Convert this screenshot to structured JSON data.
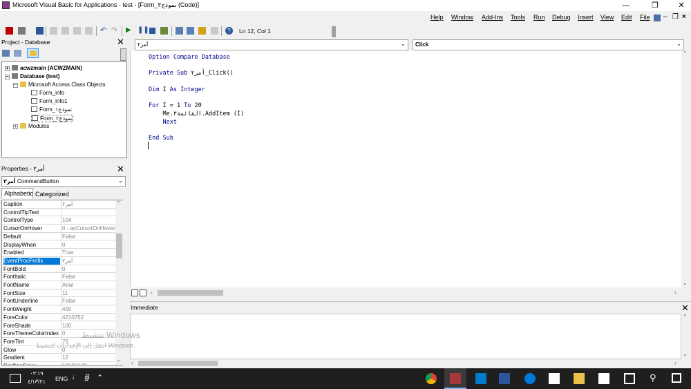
{
  "window": {
    "title": "Microsoft Visual Basic for Applications - test - [Form_نموذج٢ (Code)]"
  },
  "menus": [
    "Help",
    "Window",
    "Add-Ins",
    "Tools",
    "Run",
    "Debug",
    "Insert",
    "View",
    "Edit",
    "File"
  ],
  "toolbar": {
    "position": "Ln 12, Col 1"
  },
  "project": {
    "title": "Project - Database",
    "tree": [
      {
        "label": "acwzmain (ACWZMAIN)",
        "level": 0,
        "bold": true,
        "icon": "project-icon"
      },
      {
        "label": "Database (test)",
        "level": 0,
        "bold": true,
        "icon": "project-icon"
      },
      {
        "label": "Microsoft Access Class Objects",
        "level": 1,
        "bold": false,
        "icon": "folder-icon"
      },
      {
        "label": "Form_info",
        "level": 2,
        "bold": false,
        "icon": "form-icon"
      },
      {
        "label": "Form_info1",
        "level": 2,
        "bold": false,
        "icon": "form-icon"
      },
      {
        "label": "Form_نموذج١",
        "level": 2,
        "bold": false,
        "icon": "form-icon"
      },
      {
        "label": "Form_نموذج٢",
        "level": 2,
        "bold": false,
        "icon": "form-icon"
      },
      {
        "label": "Modules",
        "level": 1,
        "bold": false,
        "icon": "folder-icon"
      }
    ]
  },
  "properties": {
    "title": "Properties - أمر٢",
    "object_name": "أمر٢",
    "object_type": "CommandButton",
    "tabs": [
      "Alphabetic",
      "Categorized"
    ],
    "rows": [
      {
        "name": "Caption",
        "value": "أمر٢"
      },
      {
        "name": "ControlTipText",
        "value": ""
      },
      {
        "name": "ControlType",
        "value": "104"
      },
      {
        "name": "CursorOnHover",
        "value": "0 - acCursorOnHoverDefault"
      },
      {
        "name": "Default",
        "value": "False"
      },
      {
        "name": "DisplayWhen",
        "value": "0"
      },
      {
        "name": "Enabled",
        "value": "True"
      },
      {
        "name": "EventProcPrefix",
        "value": "أمر٢",
        "selected": true
      },
      {
        "name": "FontBold",
        "value": "0"
      },
      {
        "name": "FontItalic",
        "value": "False"
      },
      {
        "name": "FontName",
        "value": "Arial"
      },
      {
        "name": "FontSize",
        "value": "11"
      },
      {
        "name": "FontUnderline",
        "value": "False"
      },
      {
        "name": "FontWeight",
        "value": "400"
      },
      {
        "name": "ForeColor",
        "value": "4210752"
      },
      {
        "name": "ForeShade",
        "value": "100"
      },
      {
        "name": "ForeThemeColorIndex",
        "value": "0"
      },
      {
        "name": "ForeTint",
        "value": "75"
      },
      {
        "name": "Glow",
        "value": "0"
      },
      {
        "name": "Gradient",
        "value": "12"
      },
      {
        "name": "GridlineColor",
        "value": "10921638"
      }
    ]
  },
  "code": {
    "object_combo": "أمر٢",
    "proc_combo": "Click",
    "lines": [
      [
        {
          "t": "Option Compare Database",
          "k": true
        }
      ],
      [],
      [
        {
          "t": "Private Sub ",
          "k": true
        },
        {
          "t": "أمر٢_Click()",
          "k": false
        }
      ],
      [],
      [
        {
          "t": "Dim",
          "k": true
        },
        {
          "t": " I ",
          "k": false
        },
        {
          "t": "As Integer",
          "k": true
        }
      ],
      [],
      [
        {
          "t": "For",
          "k": true
        },
        {
          "t": " I = 1 ",
          "k": false
        },
        {
          "t": "To",
          "k": true
        },
        {
          "t": " 20",
          "k": false
        }
      ],
      [
        {
          "t": "    Me.القائمة٣.AddItem (I)",
          "k": false
        }
      ],
      [
        {
          "t": "    Next",
          "k": true
        }
      ],
      [],
      [
        {
          "t": "End Sub",
          "k": true
        }
      ],
      []
    ]
  },
  "immediate": {
    "title": "Immediate"
  },
  "watermark": {
    "line1": "تنشيط Windows",
    "line2": "انتقل إلى الإعدادات لتنشيط Windows."
  },
  "taskbar": {
    "time": "٠٣:١٩ م",
    "date": "٤/١٠/٢١",
    "lang": "ENG"
  },
  "colors": {
    "keyword": "#00008b",
    "selection": "#0078d7",
    "taskbar": "#1f1f1f"
  }
}
